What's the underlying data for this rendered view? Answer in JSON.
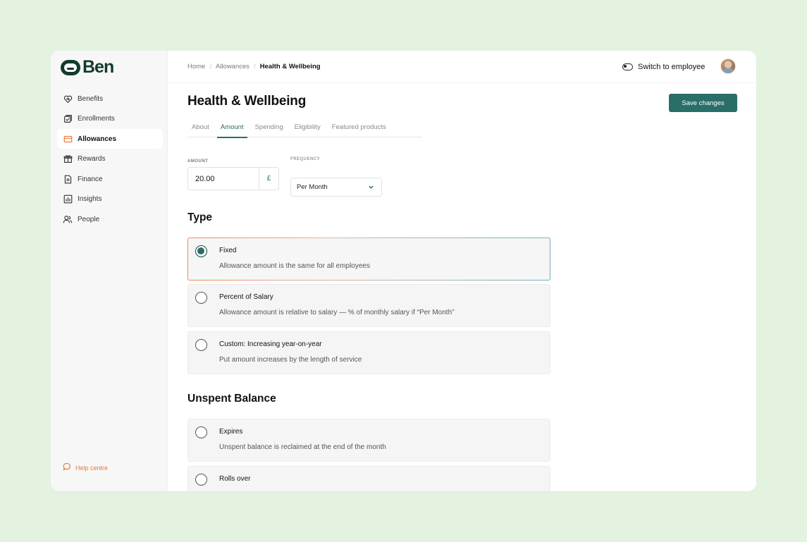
{
  "brand": {
    "name": "Ben"
  },
  "sidebar": {
    "items": [
      {
        "label": "Benefits",
        "icon": "heart-icon"
      },
      {
        "label": "Enrollments",
        "icon": "checklist-icon"
      },
      {
        "label": "Allowances",
        "icon": "card-icon",
        "active": true
      },
      {
        "label": "Rewards",
        "icon": "gift-icon"
      },
      {
        "label": "Finance",
        "icon": "document-icon"
      },
      {
        "label": "Insights",
        "icon": "chart-icon"
      },
      {
        "label": "People",
        "icon": "users-icon"
      }
    ],
    "help_label": "Help centre"
  },
  "breadcrumb": [
    "Home",
    "Allowances",
    "Health & Wellbeing"
  ],
  "header": {
    "switch_label": "Switch to employee"
  },
  "page": {
    "title": "Health & Wellbeing",
    "save_label": "Save changes",
    "tabs": [
      "About",
      "Amount",
      "Spending",
      "Eligibility",
      "Featured products"
    ],
    "active_tab": "Amount"
  },
  "amount": {
    "label": "AMOUNT",
    "value": "20.00",
    "currency": "£"
  },
  "frequency": {
    "label": "FREQUENCY",
    "value": "Per Month"
  },
  "type_section": {
    "title": "Type",
    "options": [
      {
        "title": "Fixed",
        "description": "Allowance amount is the same for all employees",
        "selected": true
      },
      {
        "title": "Percent of Salary",
        "description": "Allowance amount is relative to salary — % of monthly salary if “Per Month”",
        "selected": false
      },
      {
        "title": "Custom: Increasing year-on-year",
        "description": "Put amount increases by the length of service",
        "selected": false
      }
    ]
  },
  "unspent_section": {
    "title": "Unspent Balance",
    "options": [
      {
        "title": "Expires",
        "description": "Unspent balance is reclaimed at the end of the month",
        "selected": false
      },
      {
        "title": "Rolls over",
        "description": "",
        "selected": false
      }
    ]
  },
  "colors": {
    "accent": "#2a6e6a",
    "brand": "#123b2e",
    "help": "#e8743b",
    "background": "#e3f3e0"
  }
}
